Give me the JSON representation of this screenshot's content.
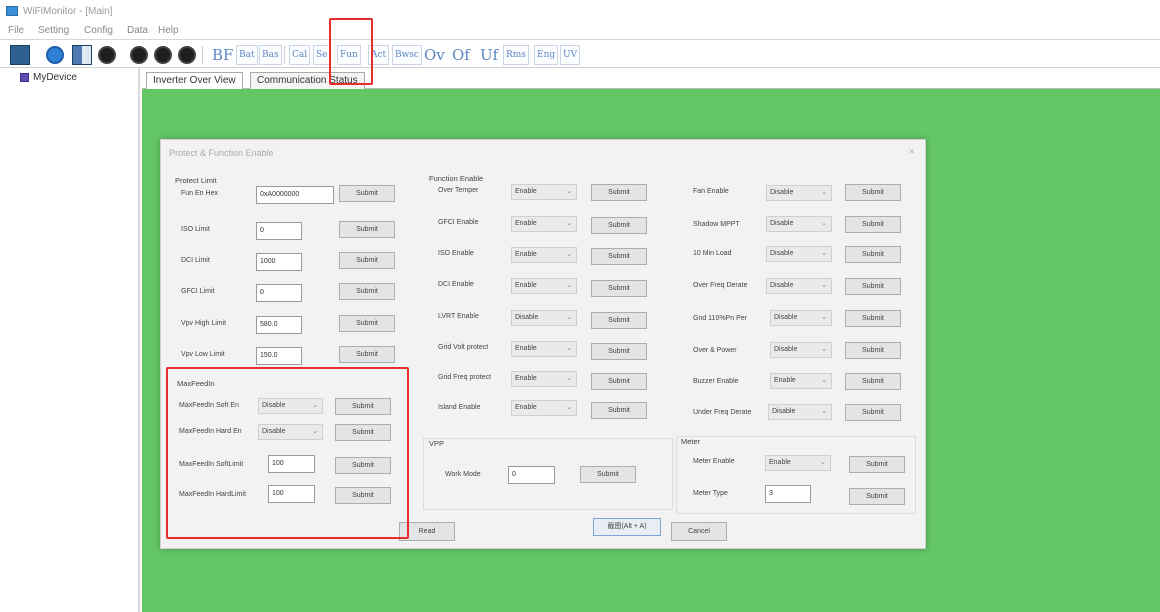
{
  "window": {
    "title": "WiFiMonitor - [Main]"
  },
  "menu": [
    "File",
    "Setting",
    "Config",
    "Data",
    "Help"
  ],
  "toolbar": {
    "text_buttons": [
      "BF",
      "Bat",
      "Bas",
      "Cal",
      "Se",
      "Fun",
      "Act",
      "Bwsc",
      "Ov",
      "Of",
      "Uf",
      "Rms",
      "Eng",
      "UV"
    ]
  },
  "tree": {
    "root_label": "MyDevice"
  },
  "tabs": [
    "Inverter Over View",
    "Communication Status"
  ],
  "dialog": {
    "title": "Protect & Function Enable",
    "close_glyph": "×",
    "protect_limit": {
      "title": "Protect Limit",
      "rows": [
        {
          "label": "Fun En Hex",
          "value": "0xA0000000",
          "button": "Submit"
        },
        {
          "label": "ISO Limit",
          "value": "0",
          "button": "Submit"
        },
        {
          "label": "DCI Limit",
          "value": "1000",
          "button": "Submit"
        },
        {
          "label": "GFCI Limit",
          "value": "0",
          "button": "Submit"
        },
        {
          "label": "Vpv High Limit",
          "value": "580.0",
          "button": "Submit"
        },
        {
          "label": "Vpv Low Limit",
          "value": "150.0",
          "button": "Submit"
        }
      ]
    },
    "maxfeedin": {
      "title": "MaxFeedIn",
      "rows": [
        {
          "label": "MaxFeedIn Soft En",
          "select": "Disable",
          "button": "Submit"
        },
        {
          "label": "MaxFeedIn Hard En",
          "select": "Disable",
          "button": "Submit"
        },
        {
          "label": "MaxFeedIn SoftLimit",
          "value": "100",
          "button": "Submit"
        },
        {
          "label": "MaxFeedIn HardLimit",
          "value": "100",
          "button": "Submit"
        }
      ]
    },
    "function_enable": {
      "title": "Function Enable",
      "left_rows": [
        {
          "label": "Over Temper",
          "select": "Enable",
          "button": "Submit"
        },
        {
          "label": "GFCI Enable",
          "select": "Enable",
          "button": "Submit"
        },
        {
          "label": "ISO Enable",
          "select": "Enable",
          "button": "Submit"
        },
        {
          "label": "DCI Enable",
          "select": "Enable",
          "button": "Submit"
        },
        {
          "label": "LVRT Enable",
          "select": "Disable",
          "button": "Submit"
        },
        {
          "label": "Grid Volt protect",
          "select": "Enable",
          "button": "Submit"
        },
        {
          "label": "Grid Freq protect",
          "select": "Enable",
          "button": "Submit"
        },
        {
          "label": "Island Enable",
          "select": "Enable",
          "button": "Submit"
        }
      ],
      "right_rows": [
        {
          "label": "Fan Enable",
          "select": "Disable",
          "button": "Submit"
        },
        {
          "label": "Shadow MPPT",
          "select": "Disable",
          "button": "Submit"
        },
        {
          "label": "10 Min Load",
          "select": "Disable",
          "button": "Submit"
        },
        {
          "label": "Over Freq Derate",
          "select": "Disable",
          "button": "Submit"
        },
        {
          "label": "Gnd 110%Pn Per",
          "select": "Disable",
          "button": "Submit"
        },
        {
          "label": "Over & Power",
          "select": "Disable",
          "button": "Submit"
        },
        {
          "label": "Buzzer Enable",
          "select": "Enable",
          "button": "Submit"
        },
        {
          "label": "Under Freq Derate",
          "select": "Disable",
          "button": "Submit"
        }
      ]
    },
    "vpp": {
      "title": "VPP",
      "label": "Work Mode",
      "value": "0",
      "button": "Submit"
    },
    "meter": {
      "title": "Meter",
      "enable_label": "Meter Enable",
      "enable_select": "Enable",
      "enable_button": "Submit",
      "type_label": "Meter Type",
      "type_value": "3",
      "type_button": "Submit"
    },
    "footer": {
      "read": "Read",
      "screenshot_hint": "截图(Alt + A)",
      "cancel": "Cancel"
    }
  },
  "colors": {
    "workspace": "#64c664",
    "annotation": "#e52d2d",
    "toolbar_text": "#5b86c4"
  }
}
